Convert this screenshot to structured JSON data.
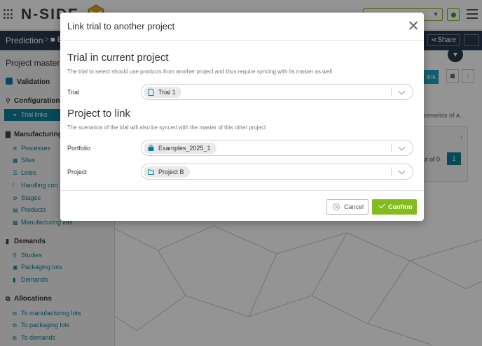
{
  "app": {
    "logo": "N-SIDE",
    "env_select": "",
    "nav": {
      "crumb": "Prediction",
      "crumb_sep": ">",
      "crumb2": "■ E",
      "share": "Share"
    },
    "sidebar": {
      "title": "Project master",
      "validation": "Validation",
      "configuration": {
        "heading": "Configuration",
        "items": [
          "Trial links"
        ]
      },
      "manufacturing": {
        "heading": "Manufacturing",
        "items": [
          "Processes",
          "Sites",
          "Lines",
          "Handling con",
          "Stages",
          "Products",
          "Manufacturing lots"
        ]
      },
      "demands": {
        "heading": "Demands",
        "items": [
          "Studies",
          "Packaging lots",
          "Demands"
        ]
      },
      "allocations": {
        "heading": "Allocations",
        "items": [
          "To manufacturing lots",
          "To packaging lots",
          "To demands"
        ]
      }
    },
    "main": {
      "link_btn": "link",
      "scenarios_text": "if scenarios of a...",
      "out_of": "out of 0",
      "page": "1"
    }
  },
  "modal": {
    "title": "Link trial to another project",
    "section1": {
      "title": "Trial in current project",
      "description": "The trial to select should use products from another project and thus require syncing with its master as well",
      "trial_label": "Trial",
      "trial_value": "Trial 1"
    },
    "section2": {
      "title": "Project to link",
      "description": "The scenarios of the trial will also be synced with the master of this other project",
      "portfolio_label": "Portfolio",
      "portfolio_value": "Examples_2025_1",
      "project_label": "Project",
      "project_value": "Project B"
    },
    "cancel_label": "Cancel",
    "confirm_label": "Confirm"
  },
  "colors": {
    "accent": "#0b7f98",
    "confirm": "#84bc1f",
    "navbar": "#263a4e"
  }
}
